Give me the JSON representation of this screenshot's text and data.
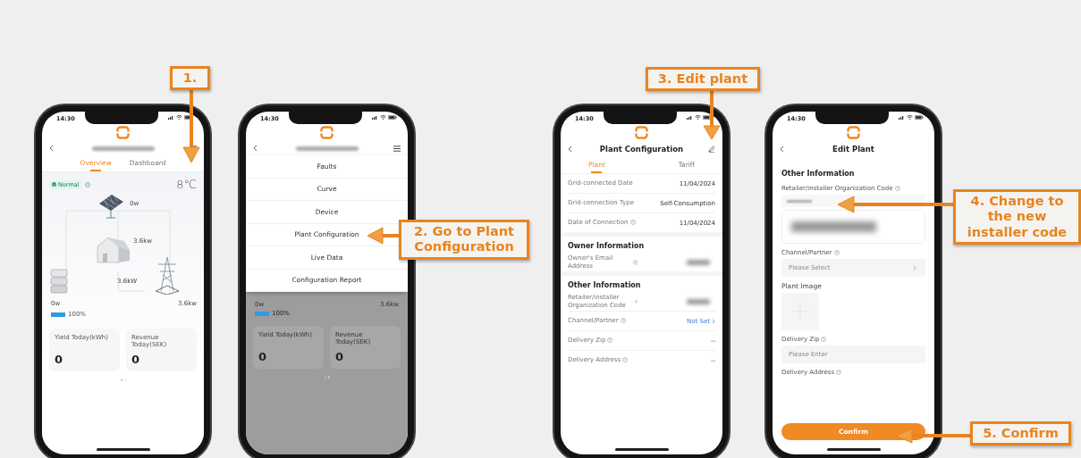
{
  "screens": [
    {
      "kind": "overview",
      "time": "14:30",
      "tabs": [
        {
          "label": "Overview",
          "selected": true
        },
        {
          "label": "Dashboard",
          "selected": false
        }
      ],
      "status": "Normal",
      "temperature": "8℃",
      "flow": {
        "solar": "0w",
        "house": "3.6kw",
        "line": "3.6kW",
        "battery": "0w",
        "grid": "3.6kw"
      },
      "battery": {
        "level": 1,
        "reading": "100%"
      },
      "cards": [
        {
          "label": "Yield Today(kWh)",
          "value": "0"
        },
        {
          "label": "Revenue Today(SEK)",
          "value": "0"
        }
      ]
    },
    {
      "kind": "menu",
      "time": "14:30",
      "menu": [
        {
          "label": "Faults"
        },
        {
          "label": "Curve"
        },
        {
          "label": "Device"
        },
        {
          "label": "Plant Configuration"
        },
        {
          "label": "Live Data"
        },
        {
          "label": "Configuration Report"
        }
      ],
      "flow": {
        "battery": "0w",
        "grid": "3.6kw"
      },
      "battery": {
        "level": 1,
        "reading": "100%"
      },
      "cards": [
        {
          "label": "Yield Today(kWh)",
          "value": "0"
        },
        {
          "label": "Revenue Today(SEK)",
          "value": "0"
        }
      ]
    },
    {
      "kind": "config",
      "time": "14:30",
      "title": "Plant Configuration",
      "tabs": [
        {
          "label": "Plant",
          "selected": true
        },
        {
          "label": "Tariff",
          "selected": false
        }
      ],
      "sections": [
        {
          "rows": [
            {
              "label": "Grid-connected Date",
              "help": false,
              "value": "11/04/2024"
            },
            {
              "label": "Grid-connection Type",
              "help": false,
              "value": "Self-Consumption"
            },
            {
              "label": "Date of Connection",
              "help": true,
              "value": "11/04/2024"
            }
          ]
        },
        {
          "heading": "Owner Information",
          "rows": [
            {
              "label": "Owner's Email Address",
              "help": true,
              "blurred": true
            }
          ]
        },
        {
          "heading": "Other Information",
          "rows": [
            {
              "label": "Retailer/installer Organization Code",
              "help": true,
              "blurred": true
            },
            {
              "label": "Channel/Partner",
              "help": true,
              "value": "Not Set",
              "link": true
            },
            {
              "label": "Delivery Zip",
              "help": true,
              "value": "--"
            },
            {
              "label": "Delivery Address",
              "help": true,
              "value": "--"
            }
          ]
        }
      ]
    },
    {
      "kind": "edit",
      "time": "14:30",
      "title": "Edit Plant",
      "section": "Other Information",
      "fields": [
        {
          "kind": "blurred-input",
          "label": "Retailer/installer Organization Code",
          "help": true
        },
        {
          "kind": "blurred-area"
        },
        {
          "kind": "select",
          "label": "Channel/Partner",
          "help": true,
          "placeholder": "Please Select"
        },
        {
          "kind": "image",
          "label": "Plant Image",
          "help": false
        },
        {
          "kind": "input",
          "label": "Delivery Zip",
          "help": true,
          "placeholder": "Please Enter"
        },
        {
          "kind": "label",
          "label": "Delivery Address",
          "help": true
        }
      ],
      "button": "Confirm"
    }
  ],
  "callouts": [
    {
      "label": "1."
    },
    {
      "label": "2. Go to Plant Configuration"
    },
    {
      "label": "3. Edit plant"
    },
    {
      "label": "4. Change to the new installer code"
    },
    {
      "label": "5. Confirm"
    }
  ]
}
